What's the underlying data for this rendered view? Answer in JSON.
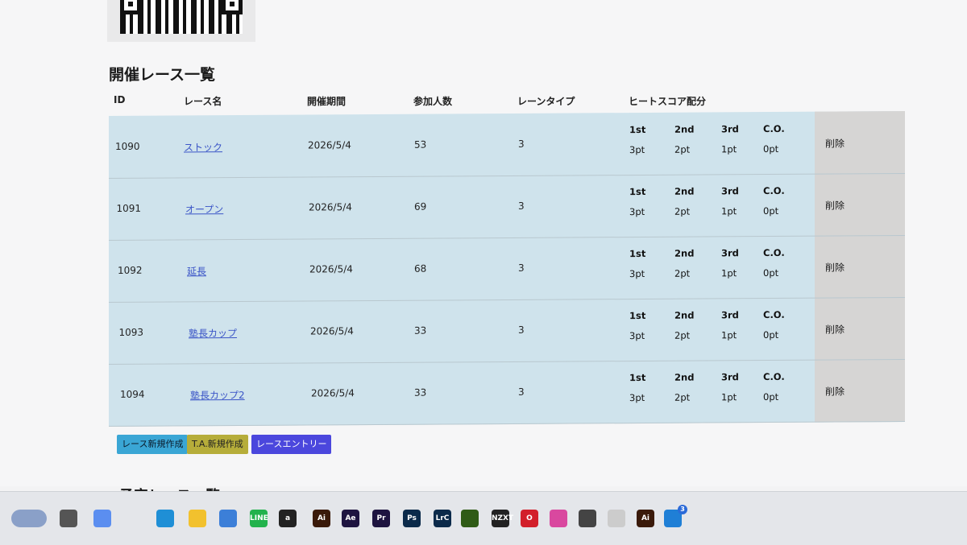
{
  "section_title": "開催レース一覧",
  "upcoming_title": "予定レース一覧",
  "columns": [
    "ID",
    "レース名",
    "開催期間",
    "参加人数",
    "レーンタイプ",
    "ヒートスコア配分"
  ],
  "score_labels": [
    "1st",
    "2nd",
    "3rd",
    "C.O."
  ],
  "score_values": [
    "3pt",
    "2pt",
    "1pt",
    "0pt"
  ],
  "delete_label": "削除",
  "rows": [
    {
      "id": "1090",
      "name": "ストック",
      "date": "2026/5/4",
      "participants": "53",
      "lane_type": "3"
    },
    {
      "id": "1091",
      "name": "オープン",
      "date": "2026/5/4",
      "participants": "69",
      "lane_type": "3"
    },
    {
      "id": "1092",
      "name": "延長",
      "date": "2026/5/4",
      "participants": "68",
      "lane_type": "3"
    },
    {
      "id": "1093",
      "name": "塾長カップ",
      "date": "2026/5/4",
      "participants": "33",
      "lane_type": "3"
    },
    {
      "id": "1094",
      "name": "塾長カップ2",
      "date": "2026/5/4",
      "participants": "33",
      "lane_type": "3"
    }
  ],
  "buttons": {
    "new_race": "レース新規作成",
    "new_ta": "T.A.新規作成",
    "race_entry": "レースエントリー"
  },
  "taskbar": [
    {
      "name": "widgets-icon",
      "label": "",
      "color": "#8aa0c8"
    },
    {
      "name": "taskview-icon",
      "label": "",
      "color": "#555555"
    },
    {
      "name": "copilot-icon",
      "label": "",
      "color": "#5b8ef0"
    },
    {
      "name": "edge-icon",
      "label": "",
      "color": "#1f8fd6"
    },
    {
      "name": "file-explorer-icon",
      "label": "",
      "color": "#f2c12e"
    },
    {
      "name": "notepad-icon",
      "label": "",
      "color": "#3c7fd8"
    },
    {
      "name": "line-icon",
      "label": "LINE",
      "color": "#22b24c"
    },
    {
      "name": "amazon-icon",
      "label": "a",
      "color": "#222222"
    },
    {
      "name": "illustrator-icon",
      "label": "Ai",
      "color": "#3a1a0a"
    },
    {
      "name": "after-effects-icon",
      "label": "Ae",
      "color": "#1e1440"
    },
    {
      "name": "premiere-icon",
      "label": "Pr",
      "color": "#1e1440"
    },
    {
      "name": "photoshop-icon",
      "label": "Ps",
      "color": "#0b2a4a"
    },
    {
      "name": "lightroom-classic-icon",
      "label": "LrC",
      "color": "#0b2a4a"
    },
    {
      "name": "nvidia-icon",
      "label": "",
      "color": "#2f5b16"
    },
    {
      "name": "nzxt-icon",
      "label": "NZXT",
      "color": "#222222"
    },
    {
      "name": "opera-icon",
      "label": "O",
      "color": "#d21f2a"
    },
    {
      "name": "app-store-icon",
      "label": "",
      "color": "#d9489f"
    },
    {
      "name": "inkscape-icon",
      "label": "",
      "color": "#444444"
    },
    {
      "name": "app-launcher-icon",
      "label": "",
      "color": "#cccccc"
    },
    {
      "name": "illustrator-2-icon",
      "label": "Ai",
      "color": "#3a1a0a"
    },
    {
      "name": "remote-desktop-icon",
      "label": "",
      "color": "#1f7fd6",
      "badge": "3"
    }
  ]
}
